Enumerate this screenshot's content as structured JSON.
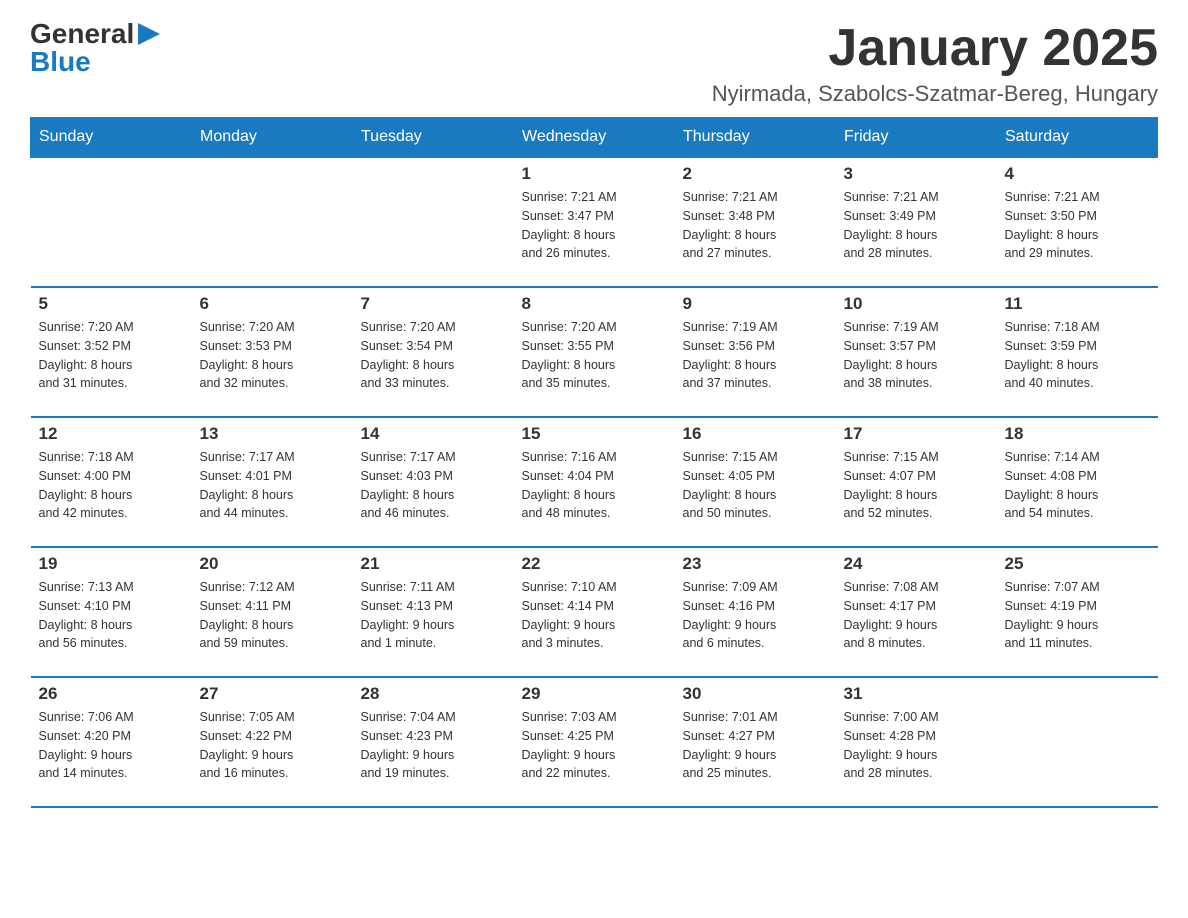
{
  "header": {
    "logo_general": "General",
    "logo_blue": "Blue",
    "title": "January 2025",
    "subtitle": "Nyirmada, Szabolcs-Szatmar-Bereg, Hungary"
  },
  "days_of_week": [
    "Sunday",
    "Monday",
    "Tuesday",
    "Wednesday",
    "Thursday",
    "Friday",
    "Saturday"
  ],
  "weeks": [
    [
      {
        "day": "",
        "info": ""
      },
      {
        "day": "",
        "info": ""
      },
      {
        "day": "",
        "info": ""
      },
      {
        "day": "1",
        "info": "Sunrise: 7:21 AM\nSunset: 3:47 PM\nDaylight: 8 hours\nand 26 minutes."
      },
      {
        "day": "2",
        "info": "Sunrise: 7:21 AM\nSunset: 3:48 PM\nDaylight: 8 hours\nand 27 minutes."
      },
      {
        "day": "3",
        "info": "Sunrise: 7:21 AM\nSunset: 3:49 PM\nDaylight: 8 hours\nand 28 minutes."
      },
      {
        "day": "4",
        "info": "Sunrise: 7:21 AM\nSunset: 3:50 PM\nDaylight: 8 hours\nand 29 minutes."
      }
    ],
    [
      {
        "day": "5",
        "info": "Sunrise: 7:20 AM\nSunset: 3:52 PM\nDaylight: 8 hours\nand 31 minutes."
      },
      {
        "day": "6",
        "info": "Sunrise: 7:20 AM\nSunset: 3:53 PM\nDaylight: 8 hours\nand 32 minutes."
      },
      {
        "day": "7",
        "info": "Sunrise: 7:20 AM\nSunset: 3:54 PM\nDaylight: 8 hours\nand 33 minutes."
      },
      {
        "day": "8",
        "info": "Sunrise: 7:20 AM\nSunset: 3:55 PM\nDaylight: 8 hours\nand 35 minutes."
      },
      {
        "day": "9",
        "info": "Sunrise: 7:19 AM\nSunset: 3:56 PM\nDaylight: 8 hours\nand 37 minutes."
      },
      {
        "day": "10",
        "info": "Sunrise: 7:19 AM\nSunset: 3:57 PM\nDaylight: 8 hours\nand 38 minutes."
      },
      {
        "day": "11",
        "info": "Sunrise: 7:18 AM\nSunset: 3:59 PM\nDaylight: 8 hours\nand 40 minutes."
      }
    ],
    [
      {
        "day": "12",
        "info": "Sunrise: 7:18 AM\nSunset: 4:00 PM\nDaylight: 8 hours\nand 42 minutes."
      },
      {
        "day": "13",
        "info": "Sunrise: 7:17 AM\nSunset: 4:01 PM\nDaylight: 8 hours\nand 44 minutes."
      },
      {
        "day": "14",
        "info": "Sunrise: 7:17 AM\nSunset: 4:03 PM\nDaylight: 8 hours\nand 46 minutes."
      },
      {
        "day": "15",
        "info": "Sunrise: 7:16 AM\nSunset: 4:04 PM\nDaylight: 8 hours\nand 48 minutes."
      },
      {
        "day": "16",
        "info": "Sunrise: 7:15 AM\nSunset: 4:05 PM\nDaylight: 8 hours\nand 50 minutes."
      },
      {
        "day": "17",
        "info": "Sunrise: 7:15 AM\nSunset: 4:07 PM\nDaylight: 8 hours\nand 52 minutes."
      },
      {
        "day": "18",
        "info": "Sunrise: 7:14 AM\nSunset: 4:08 PM\nDaylight: 8 hours\nand 54 minutes."
      }
    ],
    [
      {
        "day": "19",
        "info": "Sunrise: 7:13 AM\nSunset: 4:10 PM\nDaylight: 8 hours\nand 56 minutes."
      },
      {
        "day": "20",
        "info": "Sunrise: 7:12 AM\nSunset: 4:11 PM\nDaylight: 8 hours\nand 59 minutes."
      },
      {
        "day": "21",
        "info": "Sunrise: 7:11 AM\nSunset: 4:13 PM\nDaylight: 9 hours\nand 1 minute."
      },
      {
        "day": "22",
        "info": "Sunrise: 7:10 AM\nSunset: 4:14 PM\nDaylight: 9 hours\nand 3 minutes."
      },
      {
        "day": "23",
        "info": "Sunrise: 7:09 AM\nSunset: 4:16 PM\nDaylight: 9 hours\nand 6 minutes."
      },
      {
        "day": "24",
        "info": "Sunrise: 7:08 AM\nSunset: 4:17 PM\nDaylight: 9 hours\nand 8 minutes."
      },
      {
        "day": "25",
        "info": "Sunrise: 7:07 AM\nSunset: 4:19 PM\nDaylight: 9 hours\nand 11 minutes."
      }
    ],
    [
      {
        "day": "26",
        "info": "Sunrise: 7:06 AM\nSunset: 4:20 PM\nDaylight: 9 hours\nand 14 minutes."
      },
      {
        "day": "27",
        "info": "Sunrise: 7:05 AM\nSunset: 4:22 PM\nDaylight: 9 hours\nand 16 minutes."
      },
      {
        "day": "28",
        "info": "Sunrise: 7:04 AM\nSunset: 4:23 PM\nDaylight: 9 hours\nand 19 minutes."
      },
      {
        "day": "29",
        "info": "Sunrise: 7:03 AM\nSunset: 4:25 PM\nDaylight: 9 hours\nand 22 minutes."
      },
      {
        "day": "30",
        "info": "Sunrise: 7:01 AM\nSunset: 4:27 PM\nDaylight: 9 hours\nand 25 minutes."
      },
      {
        "day": "31",
        "info": "Sunrise: 7:00 AM\nSunset: 4:28 PM\nDaylight: 9 hours\nand 28 minutes."
      },
      {
        "day": "",
        "info": ""
      }
    ]
  ]
}
